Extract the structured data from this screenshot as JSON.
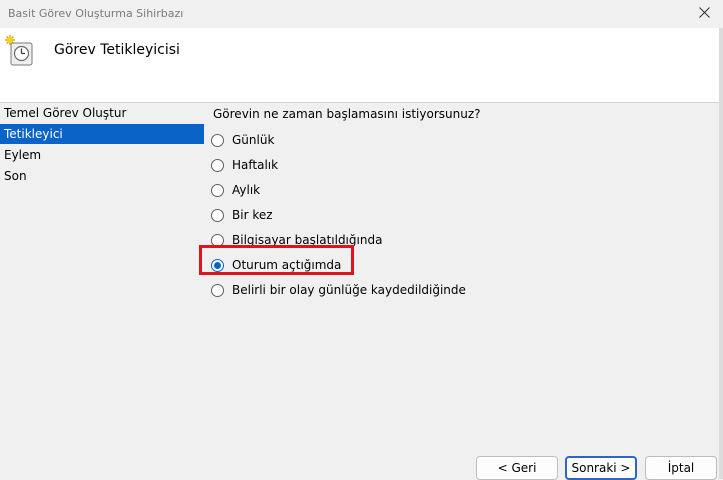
{
  "window": {
    "title": "Basit Görev Oluşturma Sihirbazı"
  },
  "header": {
    "title": "Görev Tetikleyicisi",
    "icon": "task-clock-icon"
  },
  "sidebar": {
    "items": [
      {
        "label": "Temel Görev Oluştur",
        "selected": false
      },
      {
        "label": "Tetikleyici",
        "selected": true
      },
      {
        "label": "Eylem",
        "selected": false
      },
      {
        "label": "Son",
        "selected": false
      }
    ]
  },
  "main": {
    "question": "Görevin ne zaman başlamasını istiyorsunuz?",
    "options": [
      {
        "label": "Günlük",
        "checked": false
      },
      {
        "label": "Haftalık",
        "checked": false
      },
      {
        "label": "Aylık",
        "checked": false
      },
      {
        "label": "Bir kez",
        "checked": false
      },
      {
        "label": "Bilgisayar başlatıldığında",
        "checked": false
      },
      {
        "label": "Oturum açtığımda",
        "checked": true
      },
      {
        "label": "Belirli bir olay günlüğe kaydedildiğinde",
        "checked": false
      }
    ],
    "highlight_color": "#e0121b"
  },
  "footer": {
    "back_label": "< Geri",
    "next_label": "Sonraki >",
    "cancel_label": "İptal"
  },
  "colors": {
    "accent": "#0a64c8",
    "background": "#f0f0f0"
  }
}
